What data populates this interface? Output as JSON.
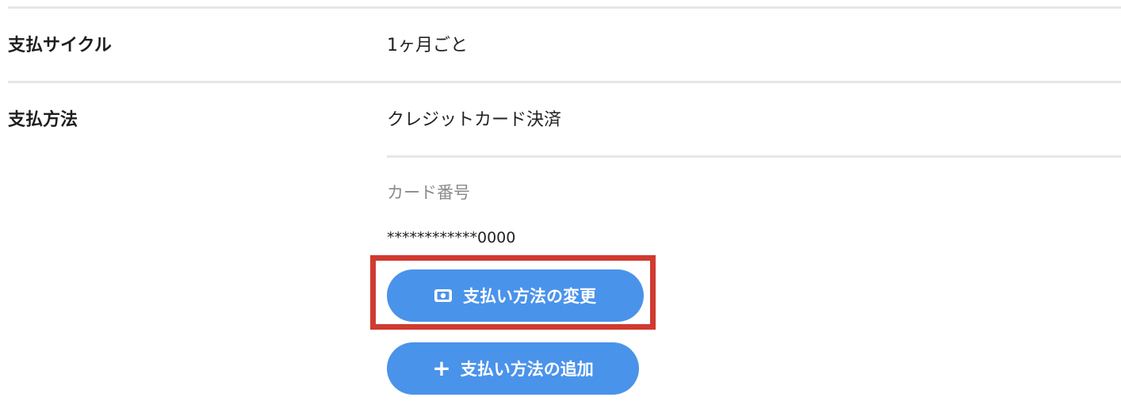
{
  "rows": {
    "cycle": {
      "label": "支払サイクル",
      "value": "1ヶ月ごと"
    },
    "method": {
      "label": "支払方法",
      "value": "クレジットカード決済"
    }
  },
  "card": {
    "label": "カード番号",
    "number": "************0000"
  },
  "buttons": {
    "change_label": "支払い方法の変更",
    "change_icon": "card-icon",
    "add_label": "支払い方法の追加",
    "add_icon": "plus-icon"
  },
  "colors": {
    "button_bg": "#4a93ea",
    "highlight_border": "#d03b30",
    "divider": "#e6e6e6"
  }
}
